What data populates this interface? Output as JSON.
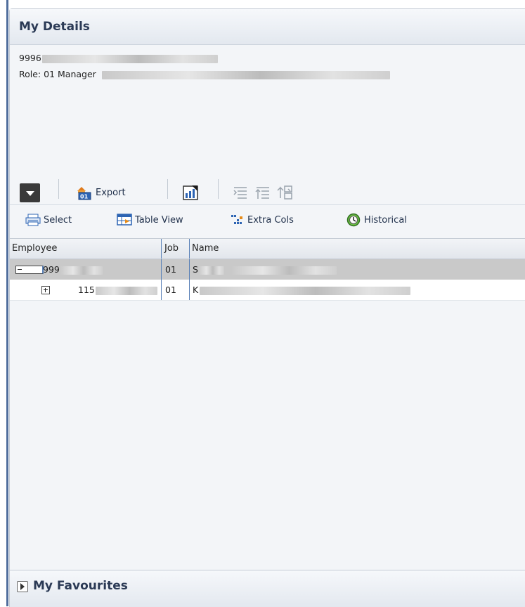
{
  "my_details": {
    "title": "My Details",
    "id_line": "9996",
    "role_label": "Role: 01 Manager"
  },
  "toolbar": {
    "export_label": "Export"
  },
  "toolbar2": {
    "select_label": "Select",
    "table_view_label": "Table View",
    "extra_cols_label": "Extra Cols",
    "historical_label": "Historical"
  },
  "table": {
    "headers": [
      "Employee",
      "Job",
      "Name"
    ],
    "rows": [
      {
        "employee": "999",
        "job": "01",
        "name": "S",
        "tree": "collapse"
      },
      {
        "employee": "115",
        "job": "01",
        "name": "K",
        "tree": "expand"
      }
    ]
  },
  "favourites": {
    "title": "My Favourites"
  },
  "icons": {
    "dropdown": "chevron-down-icon",
    "export": "export-icon",
    "chart": "chart-icon",
    "indent": "indent-icon",
    "outdent": "outdent-icon",
    "move": "move-icon",
    "select": "select-icon",
    "table_view": "table-view-icon",
    "extra_cols": "extra-cols-icon",
    "historical": "historical-icon",
    "favourites_toggle": "chevron-right-icon"
  },
  "colors": {
    "header_title": "#2b3a55",
    "selected_row": "#c9c9c9",
    "column_separator": "#5b82b8",
    "left_rule": "#4f6d9c"
  }
}
